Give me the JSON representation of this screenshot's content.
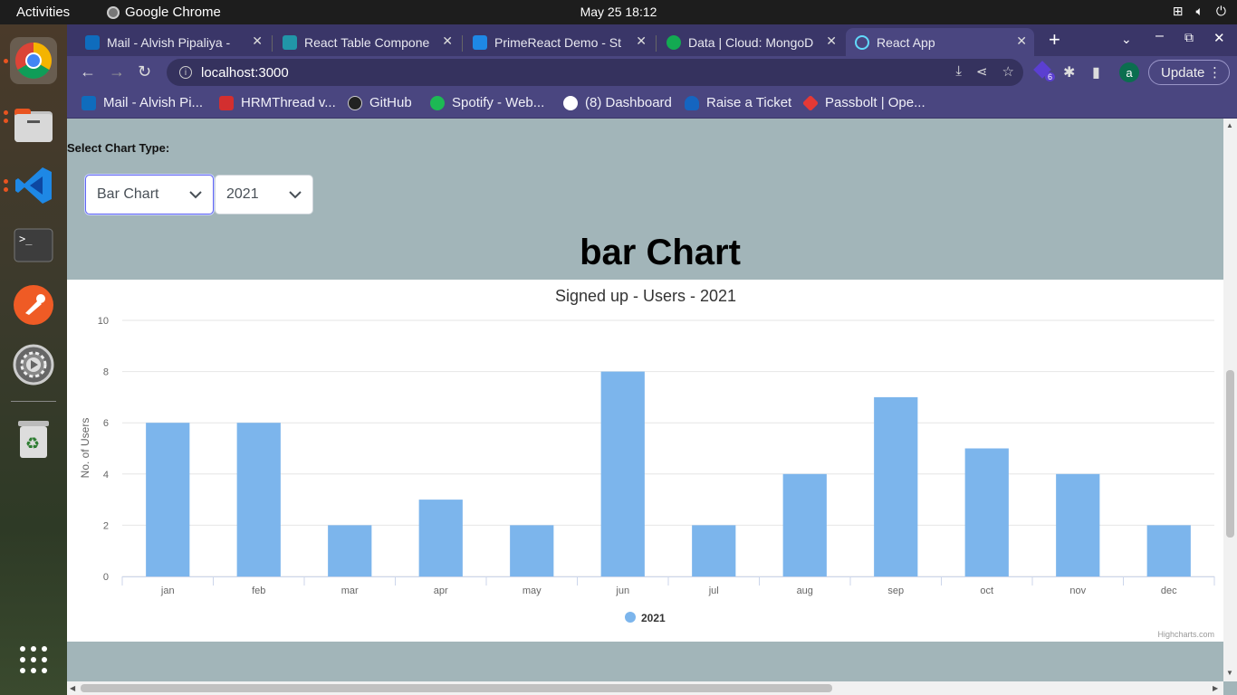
{
  "system": {
    "activities_label": "Activities",
    "app_name": "Google Chrome",
    "datetime": "May 25  18:12"
  },
  "tabs": [
    {
      "title": "Mail - Alvish Pipaliya -",
      "favicon_color": "#0f6cbd"
    },
    {
      "title": "React Table Compone",
      "favicon_color": "#61dafb"
    },
    {
      "title": "PrimeReact Demo - St",
      "favicon_color": "#1e88e5"
    },
    {
      "title": "Data | Cloud: MongoD",
      "favicon_color": "#13aa52"
    },
    {
      "title": "React App",
      "favicon_color": "#61dafb"
    }
  ],
  "address_bar": {
    "url": "localhost:3000"
  },
  "profile_initial": "a",
  "update_label": "Update",
  "extension_badge": "6",
  "bookmarks": [
    {
      "label": "Mail - Alvish Pi...",
      "favicon_color": "#0f6cbd"
    },
    {
      "label": "HRMThread v...",
      "favicon_color": "#d32f2f"
    },
    {
      "label": "GitHub",
      "favicon_color": "#222222"
    },
    {
      "label": "Spotify - Web...",
      "favicon_color": "#1db954"
    },
    {
      "label": "(8) Dashboard",
      "favicon_color": "#ffffff"
    },
    {
      "label": "Raise a Ticket",
      "favicon_color": "#1565c0"
    },
    {
      "label": "Passbolt | Ope...",
      "favicon_color": "#e53935"
    }
  ],
  "page": {
    "select_label": "Select Chart Type:",
    "chart_type_select": "Bar Chart",
    "year_select": "2021",
    "heading": "bar Chart",
    "credits": "Highcharts.com"
  },
  "chart_data": {
    "type": "bar",
    "title": "Signed up - Users - 2021",
    "xlabel": "",
    "ylabel": "No. of Users",
    "categories": [
      "jan",
      "feb",
      "mar",
      "apr",
      "may",
      "jun",
      "jul",
      "aug",
      "sep",
      "oct",
      "nov",
      "dec"
    ],
    "series": [
      {
        "name": "2021",
        "values": [
          6,
          6,
          2,
          3,
          2,
          8,
          2,
          4,
          7,
          5,
          4,
          2
        ],
        "color": "#7cb5ec"
      }
    ],
    "ylim": [
      0,
      10
    ],
    "yticks": [
      0,
      2,
      4,
      6,
      8,
      10
    ],
    "grid": true,
    "legend_position": "bottom-center"
  }
}
